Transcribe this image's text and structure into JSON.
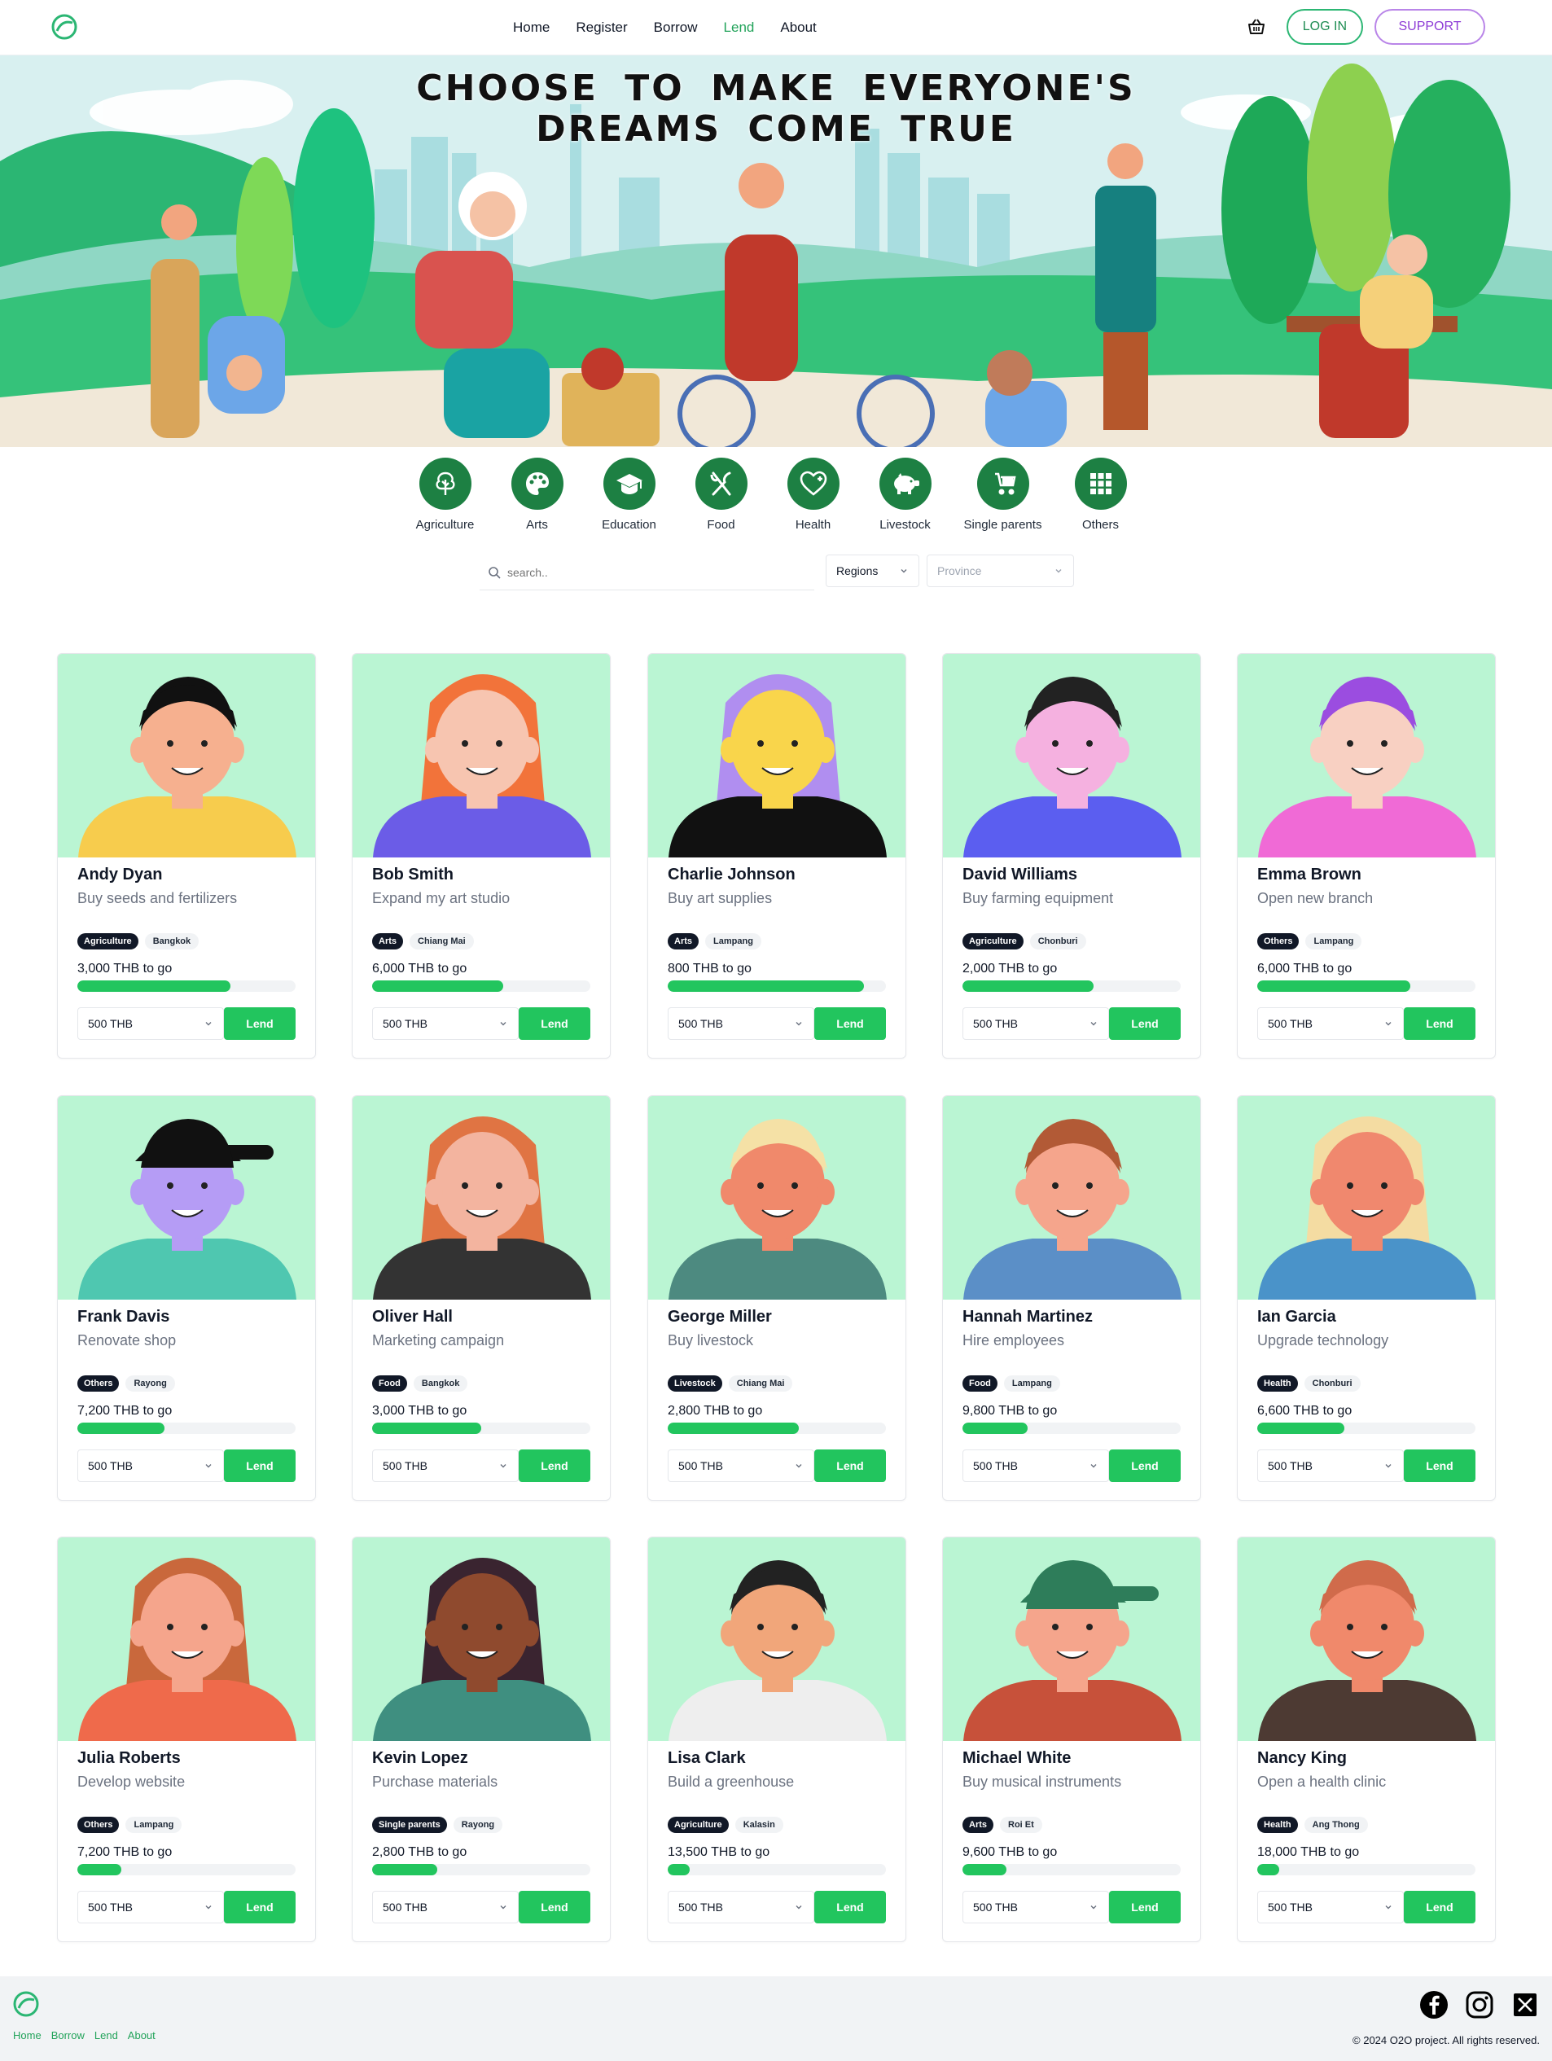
{
  "nav": {
    "links": [
      {
        "label": "Home",
        "active": false
      },
      {
        "label": "Register",
        "active": false
      },
      {
        "label": "Borrow",
        "active": false
      },
      {
        "label": "Lend",
        "active": true
      },
      {
        "label": "About",
        "active": false
      }
    ],
    "login_label": "LOG IN",
    "support_label": "SUPPORT"
  },
  "hero": {
    "line1": "CHOOSE TO MAKE EVERYONE'S",
    "line2": "DREAMS COME TRUE"
  },
  "categories": [
    {
      "label": "Agriculture",
      "icon": "tree-icon"
    },
    {
      "label": "Arts",
      "icon": "palette-icon"
    },
    {
      "label": "Education",
      "icon": "graduation-cap-icon"
    },
    {
      "label": "Food",
      "icon": "fork-knife-icon"
    },
    {
      "label": "Health",
      "icon": "heart-plus-icon"
    },
    {
      "label": "Livestock",
      "icon": "pig-icon"
    },
    {
      "label": "Single parents",
      "icon": "stroller-icon"
    },
    {
      "label": "Others",
      "icon": "grid-icon"
    }
  ],
  "filters": {
    "search_placeholder": "search..",
    "regions_label": "Regions",
    "province_label": "Province"
  },
  "colors": {
    "accent": "#22c55e",
    "category_circle": "#1d8043",
    "card_photo_bg": "#baf5d3",
    "support": "#8d3bd6"
  },
  "borrowers": [
    {
      "name": "Andy Dyan",
      "purpose": "Buy seeds and fertilizers",
      "category": "Agriculture",
      "region": "Bangkok",
      "to_go": "3,000 THB to go",
      "progress": 0.7,
      "amount": "500 THB",
      "lend_label": "Lend"
    },
    {
      "name": "Bob Smith",
      "purpose": "Expand my art studio",
      "category": "Arts",
      "region": "Chiang Mai",
      "to_go": "6,000 THB to go",
      "progress": 0.6,
      "amount": "500 THB",
      "lend_label": "Lend"
    },
    {
      "name": "Charlie Johnson",
      "purpose": "Buy art supplies",
      "category": "Arts",
      "region": "Lampang",
      "to_go": "800 THB to go",
      "progress": 0.9,
      "amount": "500 THB",
      "lend_label": "Lend"
    },
    {
      "name": "David Williams",
      "purpose": "Buy farming equipment",
      "category": "Agriculture",
      "region": "Chonburi",
      "to_go": "2,000 THB to go",
      "progress": 0.6,
      "amount": "500 THB",
      "lend_label": "Lend"
    },
    {
      "name": "Emma Brown",
      "purpose": "Open new branch",
      "category": "Others",
      "region": "Lampang",
      "to_go": "6,000 THB to go",
      "progress": 0.7,
      "amount": "500 THB",
      "lend_label": "Lend"
    },
    {
      "name": "Frank Davis",
      "purpose": "Renovate shop",
      "category": "Others",
      "region": "Rayong",
      "to_go": "7,200 THB to go",
      "progress": 0.4,
      "amount": "500 THB",
      "lend_label": "Lend"
    },
    {
      "name": "Oliver Hall",
      "purpose": "Marketing campaign",
      "category": "Food",
      "region": "Bangkok",
      "to_go": "3,000 THB to go",
      "progress": 0.5,
      "amount": "500 THB",
      "lend_label": "Lend"
    },
    {
      "name": "George Miller",
      "purpose": "Buy livestock",
      "category": "Livestock",
      "region": "Chiang Mai",
      "to_go": "2,800 THB to go",
      "progress": 0.6,
      "amount": "500 THB",
      "lend_label": "Lend"
    },
    {
      "name": "Hannah Martinez",
      "purpose": "Hire employees",
      "category": "Food",
      "region": "Lampang",
      "to_go": "9,800 THB to go",
      "progress": 0.3,
      "amount": "500 THB",
      "lend_label": "Lend"
    },
    {
      "name": "Ian Garcia",
      "purpose": "Upgrade technology",
      "category": "Health",
      "region": "Chonburi",
      "to_go": "6,600 THB to go",
      "progress": 0.4,
      "amount": "500 THB",
      "lend_label": "Lend"
    },
    {
      "name": "Julia Roberts",
      "purpose": "Develop website",
      "category": "Others",
      "region": "Lampang",
      "to_go": "7,200 THB to go",
      "progress": 0.2,
      "amount": "500 THB",
      "lend_label": "Lend"
    },
    {
      "name": "Kevin Lopez",
      "purpose": "Purchase materials",
      "category": "Single parents",
      "region": "Rayong",
      "to_go": "2,800 THB to go",
      "progress": 0.3,
      "amount": "500 THB",
      "lend_label": "Lend"
    },
    {
      "name": "Lisa Clark",
      "purpose": "Build a greenhouse",
      "category": "Agriculture",
      "region": "Kalasin",
      "to_go": "13,500 THB to go",
      "progress": 0.1,
      "amount": "500 THB",
      "lend_label": "Lend"
    },
    {
      "name": "Michael White",
      "purpose": "Buy musical instruments",
      "category": "Arts",
      "region": "Roi Et",
      "to_go": "9,600 THB to go",
      "progress": 0.2,
      "amount": "500 THB",
      "lend_label": "Lend"
    },
    {
      "name": "Nancy King",
      "purpose": "Open a health clinic",
      "category": "Health",
      "region": "Ang Thong",
      "to_go": "18,000 THB to go",
      "progress": 0.1,
      "amount": "500 THB",
      "lend_label": "Lend"
    }
  ],
  "footer": {
    "links": [
      "Home",
      "Borrow",
      "Lend",
      "About"
    ],
    "copyright": "© 2024 O2O project. All rights reserved.",
    "social": [
      "facebook-icon",
      "instagram-icon",
      "x-icon"
    ]
  }
}
